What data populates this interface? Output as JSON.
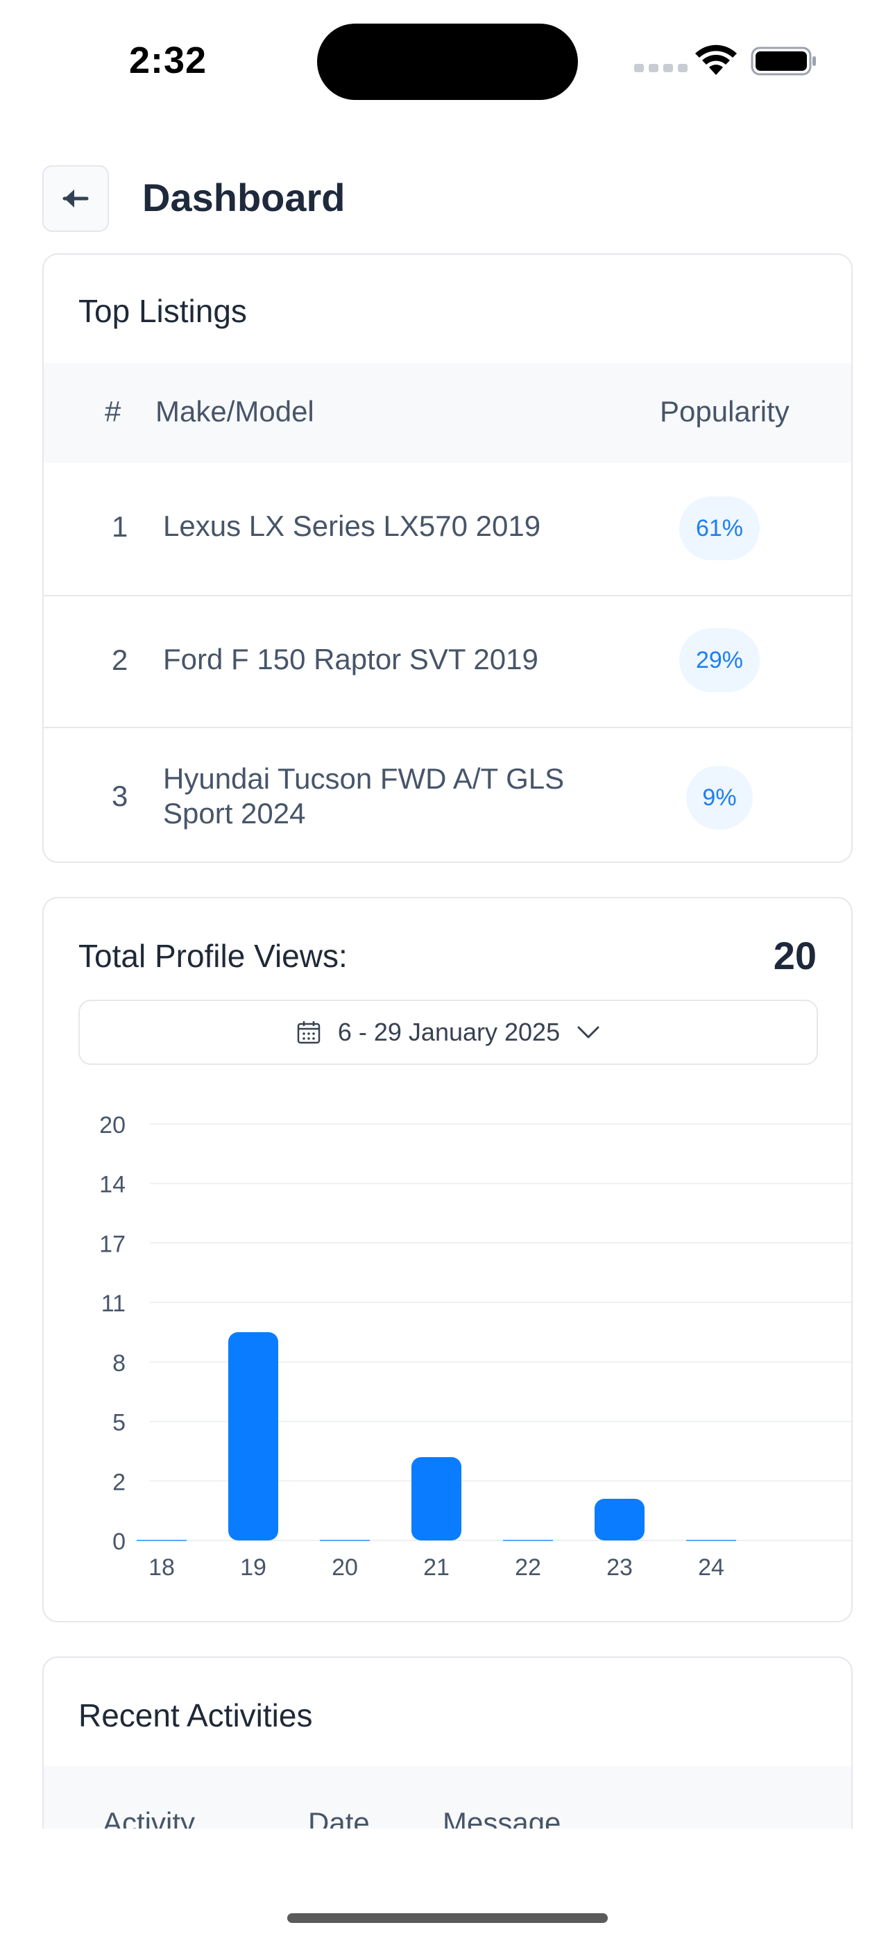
{
  "status_bar": {
    "time": "2:32"
  },
  "header": {
    "title": "Dashboard",
    "back_icon": "arrow-left-icon"
  },
  "top_listings": {
    "title": "Top Listings",
    "columns": [
      "#",
      "Make/Model",
      "Popularity"
    ],
    "rows": [
      {
        "rank": "1",
        "model": "Lexus LX Series LX570 2019",
        "popularity": "61%"
      },
      {
        "rank": "2",
        "model": "Ford F 150 Raptor SVT 2019",
        "popularity": "29%"
      },
      {
        "rank": "3",
        "model": "Hyundai Tucson FWD A/T GLS Sport 2024",
        "popularity": "9%"
      }
    ],
    "accent_color": "#1d7ff0",
    "pill_bg": "#eef6ff"
  },
  "profile_views": {
    "title": "Total Profile Views:",
    "total": "20",
    "date_range": "6 - 29 January 2025",
    "calendar_icon": "calendar-icon",
    "dropdown_icon": "chevron-down-icon",
    "bar_color": "#0a7cff"
  },
  "chart_data": {
    "type": "bar",
    "categories": [
      "18",
      "19",
      "20",
      "21",
      "22",
      "23",
      "24"
    ],
    "values": [
      0,
      10,
      0,
      4,
      0,
      2,
      0
    ],
    "yticks": [
      0,
      2,
      5,
      8,
      11,
      17,
      14,
      20
    ],
    "ylim": [
      0,
      20
    ],
    "grid": true
  },
  "recent_activities": {
    "title": "Recent Activities",
    "columns": [
      "Activity",
      "Date",
      "Message"
    ]
  }
}
